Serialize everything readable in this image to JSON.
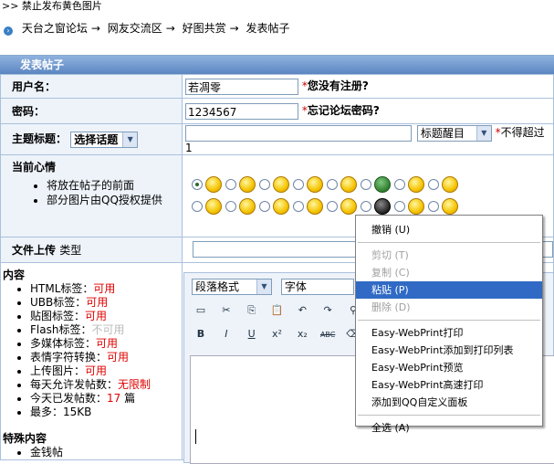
{
  "top_notice": ">> 禁止发布黄色图片",
  "breadcrumb": [
    "天台之窗论坛",
    "网友交流区",
    "好图共赏",
    "发表帖子"
  ],
  "panel_title": "发表帖子",
  "form": {
    "username_label": "用户名：",
    "username_value": "若凋零",
    "username_hint": "您没有注册?",
    "password_label": "密码：",
    "password_value": "1234567",
    "password_hint": "忘记论坛密码?",
    "subject_label": "主题标题：",
    "topic_select": "选择话题",
    "title_style_select": "标题醒目",
    "subject_hint": "不得超过 1",
    "mood_label": "当前心情",
    "mood_notes": [
      "将放在帖子的前面",
      "部分图片由QQ授权提供"
    ],
    "upload_label": "文件上传",
    "upload_type": "类型",
    "content_label": "内容",
    "content_rules": [
      {
        "name": "HTML标签：",
        "value": "可用",
        "state": "red"
      },
      {
        "name": "UBB标签：",
        "value": "可用",
        "state": "red"
      },
      {
        "name": "贴图标签：",
        "value": "可用",
        "state": "red"
      },
      {
        "name": "Flash标签：",
        "value": "不可用",
        "state": "grey"
      },
      {
        "name": "多媒体标签：",
        "value": "可用",
        "state": "red"
      },
      {
        "name": "表情字符转换：",
        "value": "可用",
        "state": "red"
      },
      {
        "name": "上传图片：",
        "value": "可用",
        "state": "red"
      },
      {
        "name": "每天允许发帖数：",
        "value": "无限制",
        "state": "red"
      },
      {
        "name": "今天已发帖数：",
        "value": "17",
        "suffix": " 篇",
        "state": "red"
      },
      {
        "name": "最多：",
        "value": "15KB",
        "state": "plain"
      }
    ],
    "special_label": "特殊内容",
    "special_items": [
      "金钱帖"
    ]
  },
  "editor": {
    "paragraph_select": "段落格式",
    "font_select": "字体"
  },
  "context_menu": {
    "items": [
      {
        "label": "撤销 (U)",
        "state": "normal"
      },
      {
        "sep": true
      },
      {
        "label": "剪切 (T)",
        "state": "disabled"
      },
      {
        "label": "复制 (C)",
        "state": "disabled"
      },
      {
        "label": "粘贴 (P)",
        "state": "highlight"
      },
      {
        "label": "删除 (D)",
        "state": "disabled"
      },
      {
        "sep": true
      },
      {
        "label": "Easy-WebPrint打印",
        "state": "normal"
      },
      {
        "label": "Easy-WebPrint添加到打印列表",
        "state": "normal"
      },
      {
        "label": "Easy-WebPrint预览",
        "state": "normal"
      },
      {
        "label": "Easy-WebPrint高速打印",
        "state": "normal"
      },
      {
        "label": "添加到QQ自定义面板",
        "state": "normal"
      },
      {
        "sep": true
      },
      {
        "label": "全选 (A)",
        "state": "normal"
      }
    ]
  },
  "colors": {
    "accent": "#316ac5",
    "header_blue": "#5c86c2",
    "required": "#cc0000"
  }
}
